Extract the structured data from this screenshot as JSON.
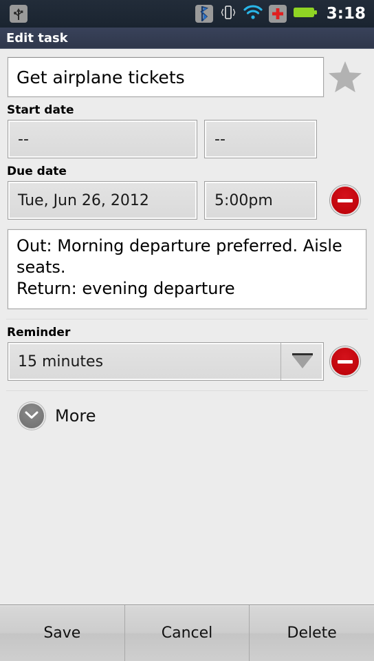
{
  "status_bar": {
    "usb_icon": "usb-icon",
    "bluetooth_icon": "bluetooth-icon",
    "vibrate_icon": "vibrate-icon",
    "wifi_icon": "wifi-icon",
    "medical_icon": "red-cross-icon",
    "battery_icon": "battery-icon",
    "clock": "3:18",
    "colors": {
      "background": "#1d2733",
      "wifi": "#29b6e8",
      "cross": "#e02020",
      "battery": "#8fd424",
      "icon_plate": "#9a9a9a"
    }
  },
  "title_bar": {
    "title": "Edit task",
    "background": "#333c52"
  },
  "task": {
    "name_value": "Get airplane tickets",
    "name_placeholder": "Task name",
    "star": {
      "name": "star-icon",
      "active": false,
      "color": "#b0b0b0"
    }
  },
  "start_date": {
    "label": "Start date",
    "date_value": "--",
    "time_value": "--"
  },
  "due_date": {
    "label": "Due date",
    "date_value": "Tue, Jun 26, 2012",
    "time_value": "5:00pm",
    "remove_icon": "minus-circle-icon",
    "remove_color": "#c30009"
  },
  "notes": {
    "value": "Out: Morning departure preferred. Aisle seats.\nReturn: evening departure",
    "placeholder": "Notes"
  },
  "reminder": {
    "label": "Reminder",
    "selected": "15 minutes",
    "options": [
      "15 minutes"
    ],
    "dropdown_icon": "chevron-down-icon",
    "remove_icon": "minus-circle-icon",
    "remove_color": "#c30009"
  },
  "more": {
    "label": "More",
    "icon": "chevron-down-circle-icon",
    "expanded": false
  },
  "bottom_bar": {
    "buttons": [
      {
        "label": "Save",
        "name": "save-button"
      },
      {
        "label": "Cancel",
        "name": "cancel-button"
      },
      {
        "label": "Delete",
        "name": "delete-button"
      }
    ]
  }
}
